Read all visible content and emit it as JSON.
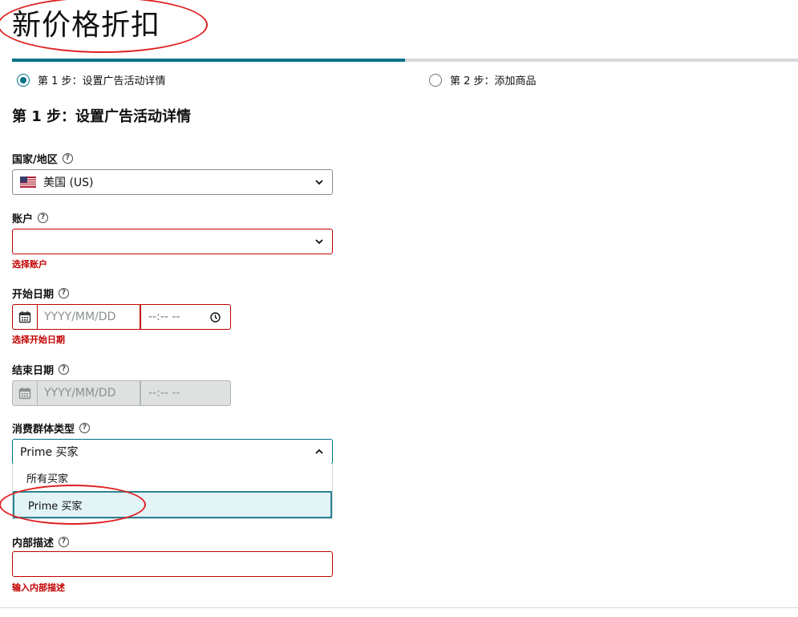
{
  "page": {
    "title": "新价格折扣"
  },
  "steps": [
    {
      "label": "第 1 步：设置广告活动详情",
      "active": true
    },
    {
      "label": "第 2 步：添加商品",
      "active": false
    }
  ],
  "section": {
    "title": "第 1 步：设置广告活动详情"
  },
  "progress": {
    "fraction": 0.5
  },
  "fields": {
    "country": {
      "label": "国家/地区",
      "help": "?",
      "value": "美国 (US)",
      "flag": "us-flag-icon"
    },
    "account": {
      "label": "账户",
      "help": "?",
      "value": "",
      "error": "选择账户"
    },
    "start_date": {
      "label": "开始日期",
      "help": "?",
      "date_placeholder": "YYYY/MM/DD",
      "time_placeholder": "--:-- --",
      "error": "选择开始日期"
    },
    "end_date": {
      "label": "结束日期",
      "help": "?",
      "date_placeholder": "YYYY/MM/DD",
      "time_placeholder": "--:-- --",
      "disabled": true
    },
    "audience": {
      "label": "消费群体类型",
      "help": "?",
      "value": "Prime 买家",
      "options": [
        "所有买家",
        "Prime 买家"
      ],
      "selected_option": "Prime 买家"
    },
    "description": {
      "label": "内部描述",
      "help": "?",
      "value": "",
      "error": "输入内部描述"
    }
  },
  "colors": {
    "accent": "#007185",
    "error": "#c40000",
    "annotation": "#e02020",
    "option_selected_bg": "#e3f4f7"
  }
}
